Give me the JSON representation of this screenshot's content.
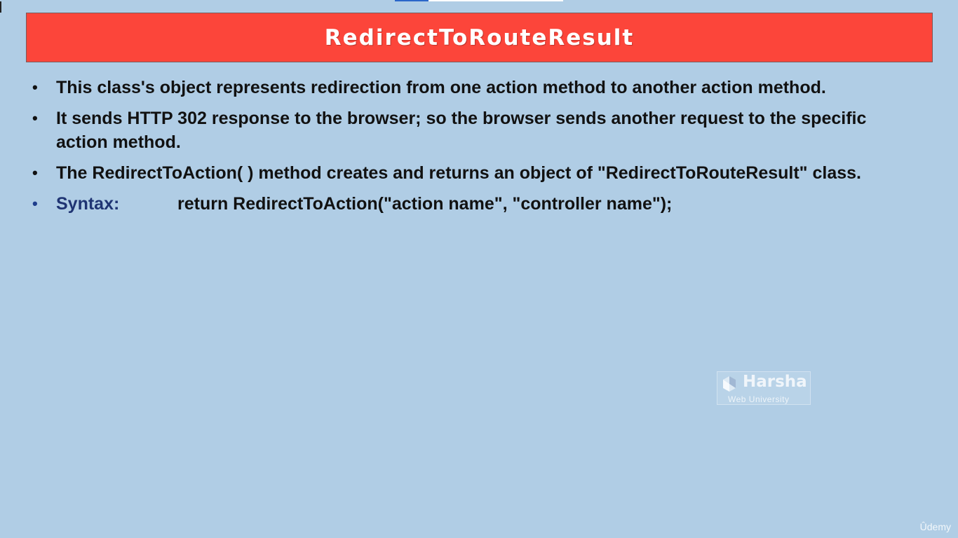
{
  "slide": {
    "title": "RedirectToRouteResult",
    "bullets": [
      "This class's object represents redirection from one action method to another action method.",
      "It sends HTTP 302 response to the browser; so the browser sends another request to the specific action method.",
      "The RedirectToAction( ) method creates and returns an object of \"RedirectToRouteResult\" class."
    ],
    "syntax": {
      "label": "Syntax:",
      "code": "return RedirectToAction(\"action name\", \"controller name\");"
    }
  },
  "watermark": {
    "brand": "Harsha",
    "subtitle": "Web University",
    "icon": "harsha-logo-icon"
  },
  "udemy_logo": "Ûdemy",
  "colors": {
    "background": "#b0cde5",
    "title_bar": "#fc453a",
    "syntax_label": "#1f3473"
  }
}
